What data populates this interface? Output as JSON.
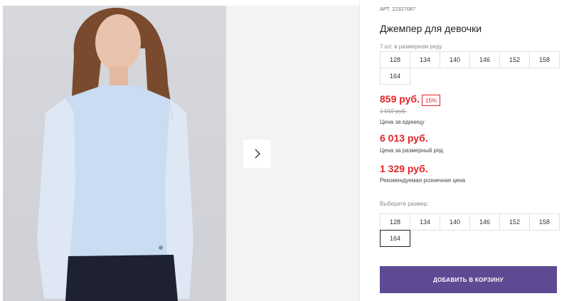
{
  "product": {
    "sku": "АРТ. 22327087",
    "title": "Джемпер для девочки",
    "row_count": "7 шт. в размерном ряду"
  },
  "size_row": [
    "128",
    "134",
    "140",
    "146",
    "152",
    "158",
    "164"
  ],
  "prices": {
    "unit_price": "859 руб.",
    "discount": "15%",
    "old_price": "1 010 руб.",
    "unit_caption": "Цена за единицу",
    "row_price": "6 013 руб.",
    "row_caption": "Цена за размерный ряд",
    "retail_price": "1 329 руб.",
    "retail_caption": "Рекомендуемая розничная цена"
  },
  "size_picker": {
    "label": "Выберите размер:",
    "options": [
      "128",
      "134",
      "140",
      "146",
      "152",
      "158",
      "164"
    ],
    "selected": "164"
  },
  "cart_button_label": "ДОБАВИТЬ В КОРЗИНУ",
  "colors": {
    "accent_purple": "#5e4a93",
    "price_red": "#e3242b",
    "jumper_blue": "#c9dcf2"
  },
  "icons": {
    "next": "chevron-right-icon"
  }
}
